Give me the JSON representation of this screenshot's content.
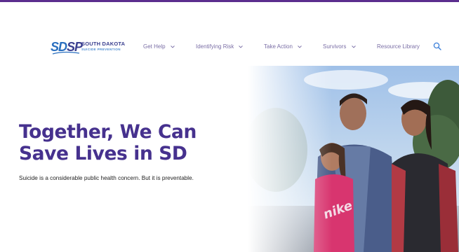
{
  "brand": {
    "logo_mark": [
      "S",
      "D",
      "S",
      "P"
    ],
    "logo_line1": "SOUTH DAKOTA",
    "logo_line2": "SUICIDE PREVENTION",
    "accent_color": "#46318e",
    "topbar_color": "#5b2d8e"
  },
  "nav": {
    "items": [
      {
        "label": "Get Help",
        "has_dropdown": true
      },
      {
        "label": "Identifying Risk",
        "has_dropdown": true
      },
      {
        "label": "Take Action",
        "has_dropdown": true
      },
      {
        "label": "Survivors",
        "has_dropdown": true
      },
      {
        "label": "Resource Library",
        "has_dropdown": false
      }
    ],
    "search_icon": "search-icon"
  },
  "hero": {
    "headline_line1": "Together, We Can",
    "headline_line2": "Save Lives in SD",
    "subtext": "Suicide is a considerable public health concern. But it is preventable.",
    "shirt_text": "nike"
  }
}
